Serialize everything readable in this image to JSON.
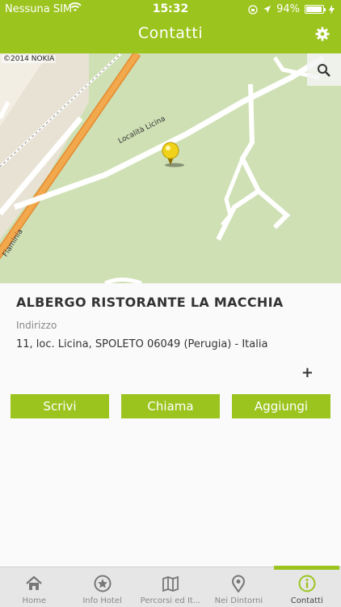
{
  "status_bar": {
    "carrier": "Nessuna SIM",
    "time": "15:32",
    "battery": "94%",
    "battery_level": 0.94
  },
  "header": {
    "title": "Contatti",
    "settings_icon": "gear-icon"
  },
  "map": {
    "copyright": "©2014 NOKIA",
    "zoom_icon": "magnifier-icon",
    "road_label": "Località Licina",
    "road_label_2": "Flaminia",
    "pin_icon": "map-pin-icon"
  },
  "hotel": {
    "name": "ALBERGO RISTORANTE LA MACCHIA",
    "address_label": "Indirizzo",
    "address": "11, loc. Licina, SPOLETO 06049 (Perugia) - Italia",
    "expand_label": "+"
  },
  "actions": {
    "write": "Scrivi",
    "call": "Chiama",
    "add": "Aggiungi"
  },
  "tabs": [
    {
      "label": "Home",
      "icon": "home-icon"
    },
    {
      "label": "Info Hotel",
      "icon": "star-badge-icon"
    },
    {
      "label": "Percorsi ed It...",
      "icon": "map-icon"
    },
    {
      "label": "Nei Dintorni",
      "icon": "location-pin-icon"
    },
    {
      "label": "Contatti",
      "icon": "info-icon"
    }
  ],
  "colors": {
    "accent": "#9cc41f",
    "map_background": "#cfe0b4",
    "road_major": "#f2a84d"
  }
}
